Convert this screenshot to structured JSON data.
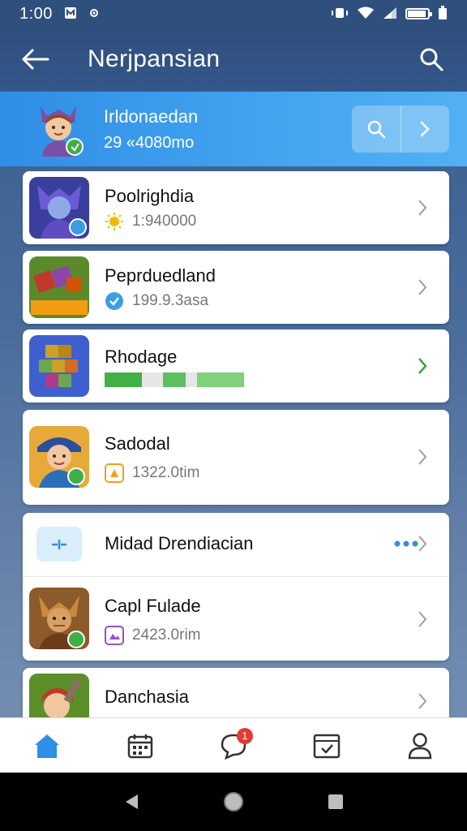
{
  "status_bar": {
    "time": "1:00"
  },
  "app_bar": {
    "title": "Nerjpansian"
  },
  "banner": {
    "title": "Irldonaedan",
    "subtitle": "29 «4080mo"
  },
  "items": [
    {
      "title": "Poolrighdia",
      "meta": "1:940000"
    },
    {
      "title": "Peprduedland",
      "meta": "199.9.3asa"
    },
    {
      "title": "Rhodage",
      "progress": 0.55
    },
    {
      "title": "Sadodal",
      "meta": "1322.0tim"
    },
    {
      "title": "Midad Drendiacian"
    },
    {
      "title": "Capl Fulade",
      "meta": "2423.0rim"
    },
    {
      "title": "Danchasia"
    }
  ],
  "colors": {
    "accent": "#2f8ee6",
    "header": "#2f4f7d",
    "progress_green": "#43b047",
    "chevron_green": "#3aa340",
    "badge_red": "#e53935"
  },
  "icons": [
    "back-arrow-icon",
    "search-icon",
    "home-icon",
    "calendar-icon",
    "chat-icon",
    "checklist-icon",
    "profile-icon"
  ],
  "bottom_nav": {
    "chat_badge": "1"
  }
}
